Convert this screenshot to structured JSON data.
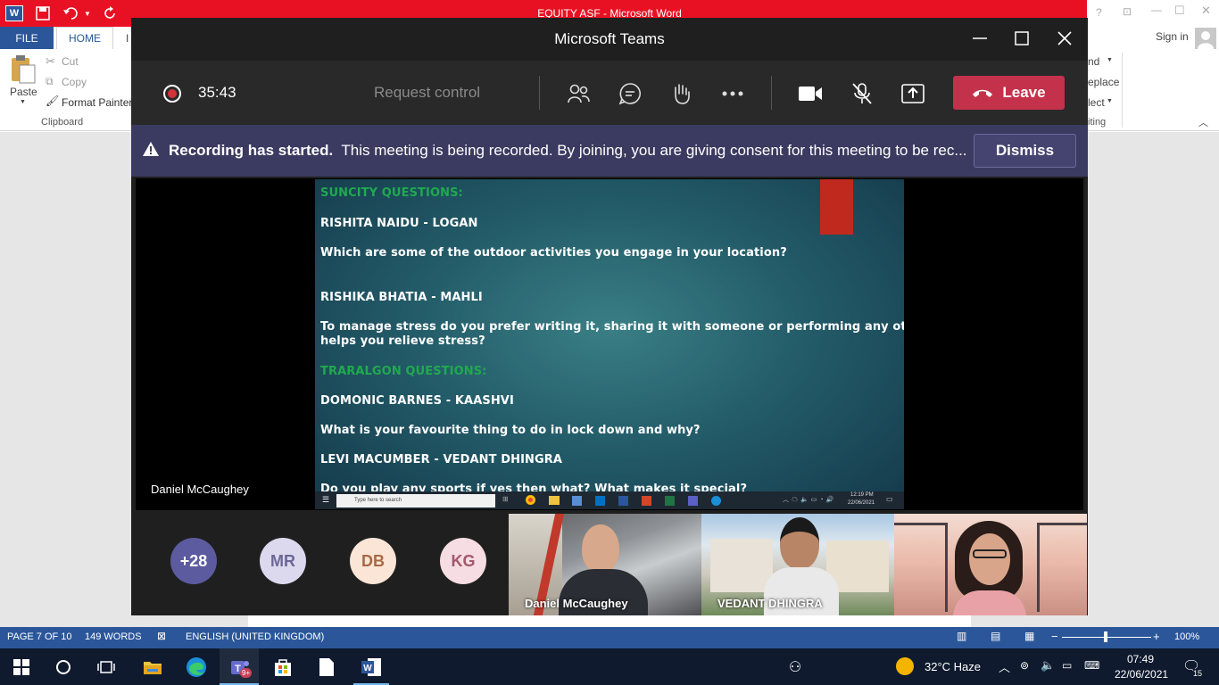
{
  "word": {
    "title": "EQUITY ASF -  Microsoft Word",
    "sign_in": "Sign in",
    "tabs": {
      "file": "FILE",
      "home": "HOME",
      "partial": "I"
    },
    "clipboard": {
      "paste": "Paste",
      "cut": "Cut",
      "copy": "Copy",
      "format_painter": "Format Painter",
      "group": "Clipboard"
    },
    "right_ribbon": {
      "find": "nd",
      "replace": "eplace",
      "select": "lect",
      "group": "iting"
    },
    "status": {
      "page": "PAGE 7 OF 10",
      "words": "149 WORDS",
      "language": "ENGLISH (UNITED KINGDOM)",
      "zoom": "100%"
    }
  },
  "teams": {
    "title": "Microsoft Teams",
    "timer": "35:43",
    "request_control": "Request control",
    "leave": "Leave",
    "banner": {
      "bold": "Recording has started.",
      "text": "This meeting is being recorded. By joining, you are giving consent for this meeting to be rec...",
      "dismiss": "Dismiss"
    },
    "presenter_name": "Daniel McCaughey",
    "shared_screen": {
      "lines": [
        {
          "text": "SUNCITY QUESTIONS:",
          "green": true
        },
        {
          "text": "RISHITA NAIDU - LOGAN",
          "green": false
        },
        {
          "text": "Which are some of the outdoor activities you engage in your location?",
          "green": false
        },
        {
          "text": "RISHIKA BHATIA - MAHLI",
          "green": false
        },
        {
          "text": "To manage stress do you prefer writing it, sharing it with someone or performing any other skill that",
          "green": false
        },
        {
          "text": "helps you relieve stress?",
          "green": false
        },
        {
          "text": "TRARALGON QUESTIONS:",
          "green": true
        },
        {
          "text": "DOMONIC BARNES  -  KAASHVI",
          "green": false
        },
        {
          "text": "What is your favourite thing to do in lock down and why?",
          "green": false
        },
        {
          "text": " LEVI MACUMBER  -  VEDANT DHINGRA",
          "green": false
        },
        {
          "text": "Do you play any sports if yes then what? What makes it special?",
          "green": false
        }
      ],
      "mini_search": "Type here to search",
      "mini_time": "12:19 PM",
      "mini_date": "22/06/2021"
    },
    "roster": {
      "overflow": "+28",
      "avatars": [
        {
          "initials": "MR",
          "bg": "#dcd9ee",
          "fg": "#6b6796"
        },
        {
          "initials": "DB",
          "bg": "#fbe5d6",
          "fg": "#a76a45"
        },
        {
          "initials": "KG",
          "bg": "#f6dde3",
          "fg": "#a3586b"
        }
      ],
      "videos": [
        {
          "name": "Daniel McCaughey"
        },
        {
          "name": "VEDANT DHINGRA"
        },
        {
          "name": ""
        }
      ]
    }
  },
  "taskbar": {
    "teams_badge": "9+",
    "weather": "32°C  Haze",
    "time": "07:49",
    "date": "22/06/2021",
    "notifications": "15"
  }
}
